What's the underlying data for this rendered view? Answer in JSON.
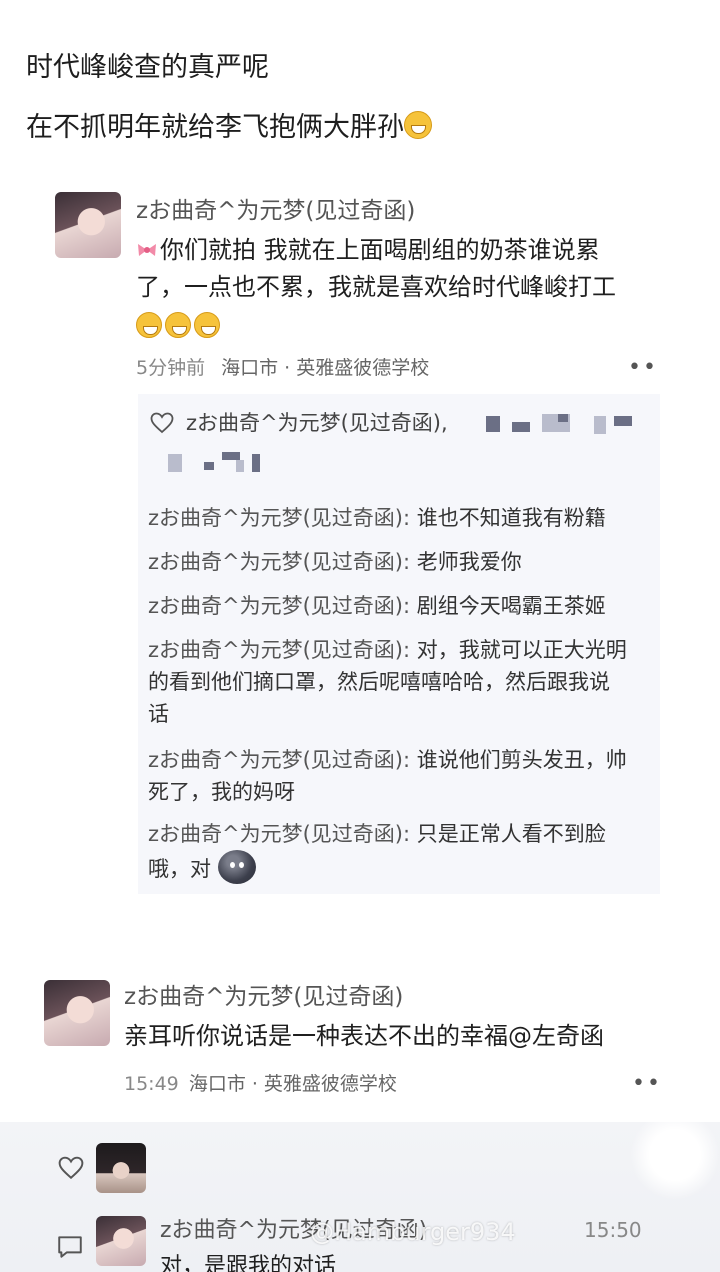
{
  "post": {
    "line1": "时代峰峻查的真严呢",
    "line2": "在不抓明年就给李飞抱俩大胖孙"
  },
  "comment1": {
    "username": "zお曲奇^为元梦(见过奇函)",
    "text_line1": "你们就拍 我就在上面喝剧组的奶茶谁说累",
    "text_line2": "了，一点也不累，我就是喜欢给时代峰峻打工",
    "time": "5分钟前",
    "location": "海口市 · 英雅盛彼德学校",
    "more_icon": "••"
  },
  "reply_box": {
    "liker_name": "zお曲奇^为元梦(见过奇函),",
    "replies": [
      {
        "name": "zお曲奇^为元梦(见过奇函):",
        "text": " 谁也不知道我有粉籍"
      },
      {
        "name": "zお曲奇^为元梦(见过奇函):",
        "text": " 老师我爱你"
      },
      {
        "name": "zお曲奇^为元梦(见过奇函):",
        "text": " 剧组今天喝霸王茶姬"
      },
      {
        "name": "zお曲奇^为元梦(见过奇函):",
        "text": " 对，我就可以正大光明",
        "cont1": "的看到他们摘口罩，然后呢嘻嘻哈哈，然后跟我说",
        "cont2": "话"
      },
      {
        "name": "zお曲奇^为元梦(见过奇函):",
        "text": " 谁说他们剪头发丑，帅",
        "cont1": "死了，我的妈呀"
      },
      {
        "name": "zお曲奇^为元梦(见过奇函):",
        "text": " 只是正常人看不到脸",
        "cont1": "哦，对"
      }
    ]
  },
  "comment2": {
    "username": "zお曲奇^为元梦(见过奇函)",
    "text": "亲耳听你说话是一种表达不出的幸福@左奇函",
    "time": "15:49",
    "location": "海口市 · 英雅盛彼德学校",
    "more_icon": "••"
  },
  "bottom": {
    "username": "zお曲奇^为元梦(见过奇函)",
    "timestamp": "15:50",
    "text": "对，是跟我的对话",
    "watermark": "@Hamburger934"
  },
  "colors": {
    "background": "#ffffff",
    "reply_bg": "#f6f7fb",
    "meta_gray": "#888888"
  }
}
